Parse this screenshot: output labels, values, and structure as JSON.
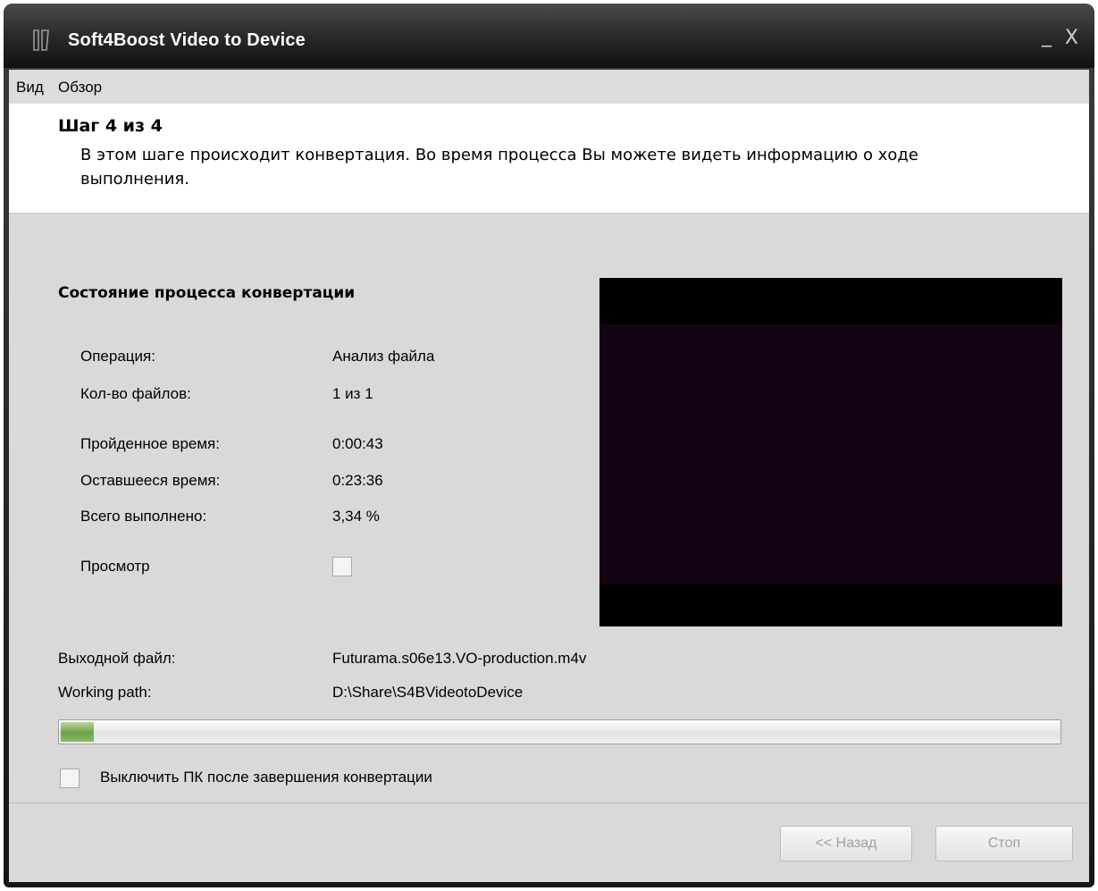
{
  "window": {
    "title": "Soft4Boost Video to Device",
    "minimize_glyph": "_",
    "close_glyph": "X"
  },
  "menu": {
    "items": [
      {
        "label": "Вид"
      },
      {
        "label": "Обзор"
      }
    ]
  },
  "header": {
    "step_title": "Шаг 4 из 4",
    "step_description": "В этом шаге происходит конвертация. Во время процесса Вы можете видеть информацию о ходе выполнения."
  },
  "status": {
    "section_title": "Состояние процесса конвертации",
    "operation_label": "Операция:",
    "operation_value": "Анализ файла",
    "files_label": "Кол-во файлов:",
    "files_value": "1 из 1",
    "elapsed_label": "Пройденное время:",
    "elapsed_value": "0:00:43",
    "remaining_label": "Оставшееся время:",
    "remaining_value": "0:23:36",
    "total_label": "Всего выполнено:",
    "total_value": "3,34 %",
    "preview_label": "Просмотр",
    "preview_checked": false
  },
  "output": {
    "output_file_label": "Выходной файл:",
    "output_file_value": "Futurama.s06e13.VO-production.m4v",
    "working_path_label": "Working path:",
    "working_path_value": "D:\\Share\\S4BVideotoDevice"
  },
  "progress": {
    "fraction": 0.0334
  },
  "shutdown": {
    "label": "Выключить ПК после завершения конвертации",
    "checked": false
  },
  "buttons": {
    "back_label": "<< Назад",
    "stop_label": "Стоп"
  },
  "colors": {
    "titlebar": "#2a2a2a",
    "client_bg": "#d9d9d9",
    "preview_bg": "#130313",
    "progress_fill": "#6da14a"
  }
}
